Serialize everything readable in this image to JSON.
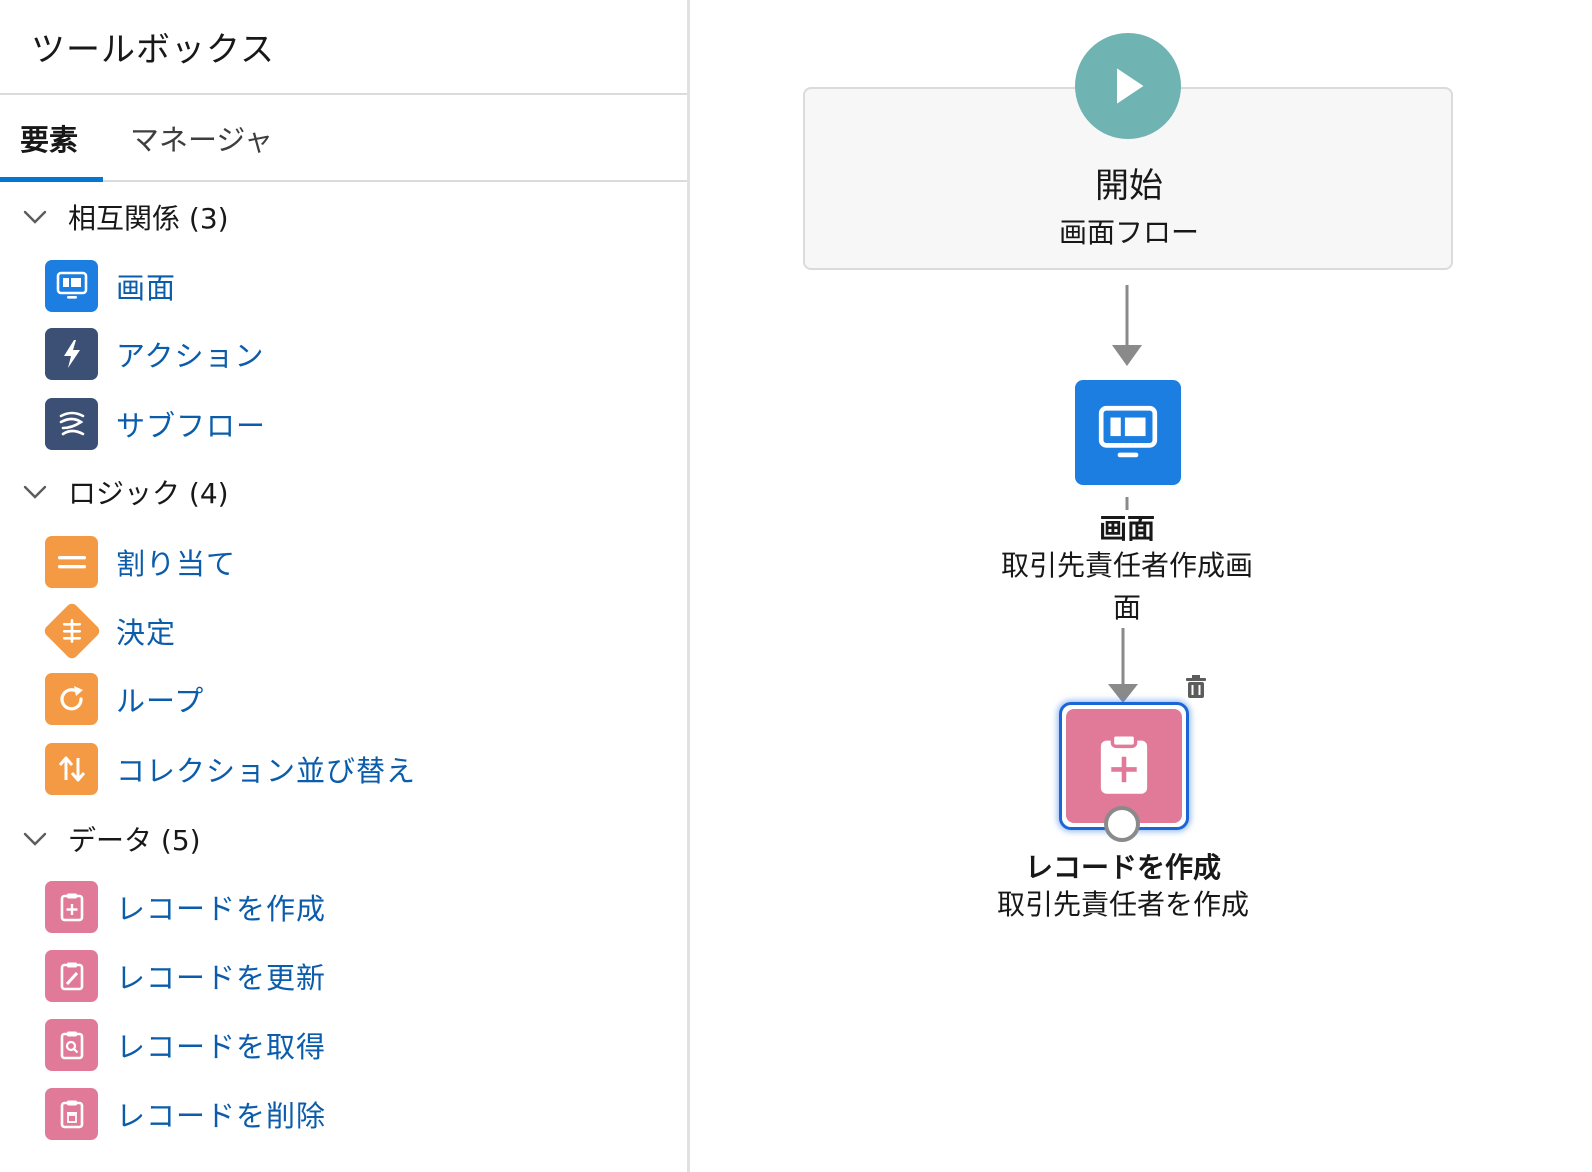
{
  "toolbox": {
    "title": "ツールボックス",
    "tabs": [
      {
        "label": "要素",
        "active": true
      },
      {
        "label": "マネージャ",
        "active": false
      }
    ],
    "sections": [
      {
        "label": "相互関係 (3)",
        "items": [
          {
            "label": "画面",
            "icon": "screen-icon",
            "color": "#1b7ee0"
          },
          {
            "label": "アクション",
            "icon": "lightning-icon",
            "color": "#3c4f75"
          },
          {
            "label": "サブフロー",
            "icon": "subflow-icon",
            "color": "#3c4f75"
          }
        ]
      },
      {
        "label": "ロジック (4)",
        "items": [
          {
            "label": "割り当て",
            "icon": "assignment-icon",
            "color": "#f49a45"
          },
          {
            "label": "決定",
            "icon": "decision-icon",
            "color": "#f49a45"
          },
          {
            "label": "ループ",
            "icon": "loop-icon",
            "color": "#f49a45"
          },
          {
            "label": "コレクション並び替え",
            "icon": "sort-icon",
            "color": "#f49a45"
          }
        ]
      },
      {
        "label": "データ (5)",
        "items": [
          {
            "label": "レコードを作成",
            "icon": "record-create-icon",
            "color": "#e07a98"
          },
          {
            "label": "レコードを更新",
            "icon": "record-update-icon",
            "color": "#e07a98"
          },
          {
            "label": "レコードを取得",
            "icon": "record-lookup-icon",
            "color": "#e07a98"
          },
          {
            "label": "レコードを削除",
            "icon": "record-delete-icon",
            "color": "#e07a98"
          }
        ]
      }
    ]
  },
  "canvas": {
    "start": {
      "title": "開始",
      "subtitle": "画面フロー",
      "color": "#6fb3b3"
    },
    "screen_node": {
      "title": "画面",
      "subtitle_line1": "取引先責任者作成画",
      "subtitle_line2": "面",
      "color": "#1b7ee0"
    },
    "record_node": {
      "title": "レコードを作成",
      "subtitle": "取引先責任者を作成",
      "color": "#e07a98"
    }
  },
  "colors": {
    "accent": "#0176d3",
    "link": "#0b5cab",
    "connector": "#8a8a8a"
  }
}
